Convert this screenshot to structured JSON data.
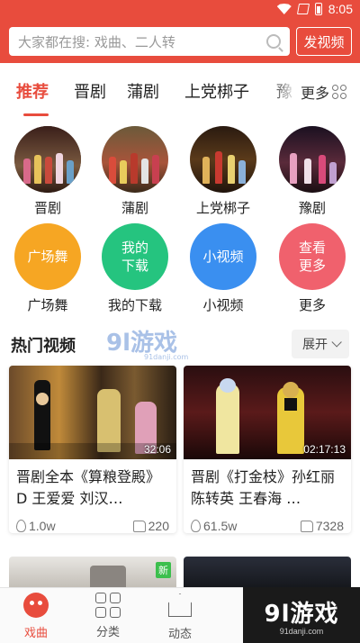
{
  "status_bar": {
    "time": "8:05"
  },
  "header": {
    "search_placeholder": "大家都在搜: 戏曲、二人转",
    "publish_label": "发视频"
  },
  "tabs": [
    {
      "label": "推荐",
      "active": true
    },
    {
      "label": "晋剧"
    },
    {
      "label": "蒲剧"
    },
    {
      "label": "上党梆子"
    },
    {
      "label": "豫剧"
    }
  ],
  "more_label": "更多",
  "categories": [
    {
      "label": "晋剧"
    },
    {
      "label": "蒲剧"
    },
    {
      "label": "上党梆子"
    },
    {
      "label": "豫剧"
    }
  ],
  "shortcuts": [
    {
      "circle_text": "广场舞",
      "label": "广场舞",
      "color": "#f6a623"
    },
    {
      "circle_text": "我的下载",
      "label": "我的下载",
      "color": "#25c47f"
    },
    {
      "circle_text": "小视频",
      "label": "小视频",
      "color": "#3a8ff0"
    },
    {
      "circle_text": "查看更多",
      "label": "更多",
      "color": "#f0616d"
    }
  ],
  "section": {
    "title": "热门视频",
    "expand_label": "展开",
    "watermark": "9l游戏",
    "watermark_sub": "91danji.com"
  },
  "videos": [
    {
      "title": "晋剧全本《算粮登殿》D 王爱爱 刘汉…",
      "duration": "32:06",
      "views": "1.0w",
      "likes": "220"
    },
    {
      "title": "晋剧《打金枝》孙红丽 陈转英 王春海 …",
      "duration": "02:17:13",
      "views": "61.5w",
      "likes": "7328"
    }
  ],
  "partial_badge": "新",
  "bottom_nav": [
    {
      "label": "戏曲",
      "active": true
    },
    {
      "label": "分类"
    },
    {
      "label": "动态"
    }
  ],
  "logo": {
    "text": "9l游戏",
    "sub": "91danji.com"
  },
  "colors": {
    "brand": "#e84c3d"
  }
}
